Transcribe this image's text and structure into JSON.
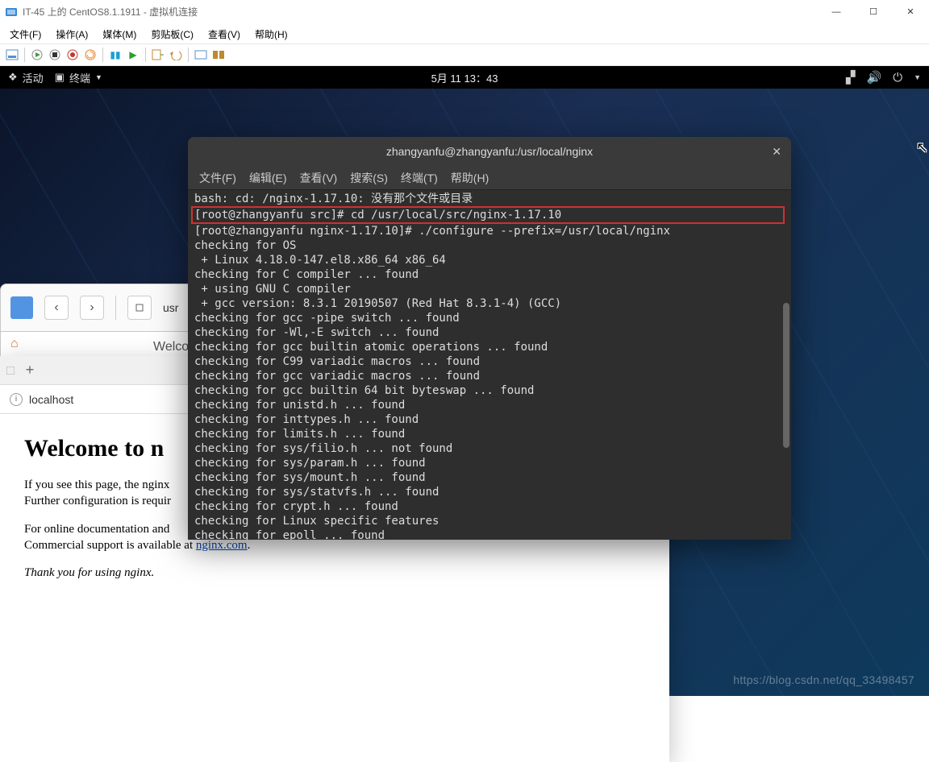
{
  "host_window": {
    "title": "IT-45 上的 CentOS8.1.1911 - 虚拟机连接",
    "menu": {
      "file": "文件(F)",
      "action": "操作(A)",
      "media": "媒体(M)",
      "clipboard": "剪贴板(C)",
      "view": "查看(V)",
      "help": "帮助(H)"
    }
  },
  "gnome": {
    "activities": "活动",
    "app": "终端",
    "clock": "5月 11 13：43"
  },
  "files": {
    "path": "usr"
  },
  "welcome_lbl": "Welcor",
  "firefox": {
    "url": "localhost",
    "h1": "Welcome to n",
    "p1a": "If you see this page, the nginx",
    "p1b": "Further configuration is requir",
    "p2a": "For online documentation and",
    "p2b_pre": "Commercial support is available at ",
    "p2b_link": "nginx.com",
    "p3": "Thank you for using nginx."
  },
  "terminal": {
    "title": "zhangyanfu@zhangyanfu:/usr/local/nginx",
    "menu": {
      "file": "文件(F)",
      "edit": "编辑(E)",
      "view": "查看(V)",
      "search": "搜索(S)",
      "terminal": "终端(T)",
      "help": "帮助(H)"
    },
    "line_top": "bash: cd: /nginx-1.17.10: 没有那个文件或目录",
    "hl": "[root@zhangyanfu src]# cd /usr/local/src/nginx-1.17.10",
    "body": "[root@zhangyanfu nginx-1.17.10]# ./configure --prefix=/usr/local/nginx\nchecking for OS\n + Linux 4.18.0-147.el8.x86_64 x86_64\nchecking for C compiler ... found\n + using GNU C compiler\n + gcc version: 8.3.1 20190507 (Red Hat 8.3.1-4) (GCC)\nchecking for gcc -pipe switch ... found\nchecking for -Wl,-E switch ... found\nchecking for gcc builtin atomic operations ... found\nchecking for C99 variadic macros ... found\nchecking for gcc variadic macros ... found\nchecking for gcc builtin 64 bit byteswap ... found\nchecking for unistd.h ... found\nchecking for inttypes.h ... found\nchecking for limits.h ... found\nchecking for sys/filio.h ... not found\nchecking for sys/param.h ... found\nchecking for sys/mount.h ... found\nchecking for sys/statvfs.h ... found\nchecking for crypt.h ... found\nchecking for Linux specific features\nchecking for epoll ... found"
  },
  "watermark": "https://blog.csdn.net/qq_33498457"
}
